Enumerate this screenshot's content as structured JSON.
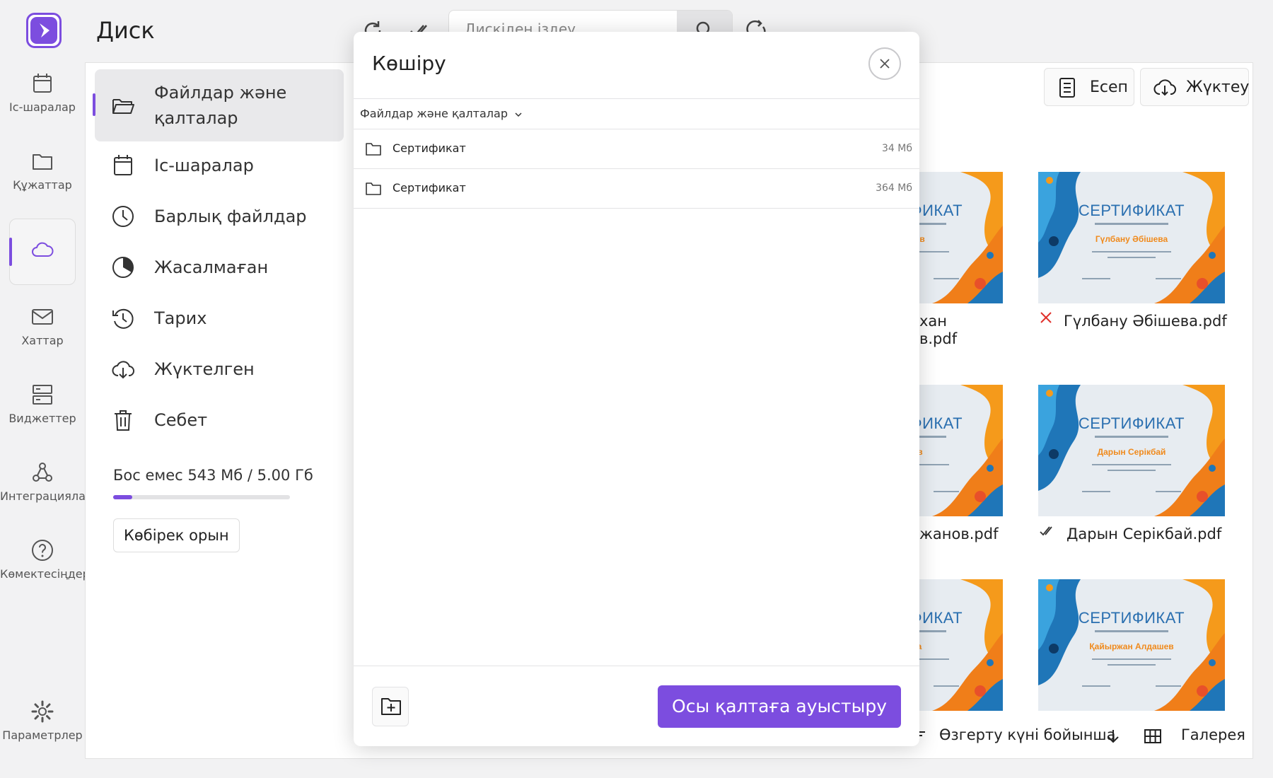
{
  "app": {
    "title": "Диск"
  },
  "rail": {
    "items": [
      {
        "label": "Іс-шаралар",
        "icon": "calendar-icon"
      },
      {
        "label": "Құжаттар",
        "icon": "folder-icon"
      },
      {
        "label": "",
        "icon": "cloud-icon",
        "active": true
      },
      {
        "label": "Хаттар",
        "icon": "mail-icon"
      },
      {
        "label": "Виджеттер",
        "icon": "widgets-icon"
      },
      {
        "label": "Интеграциялар",
        "icon": "integrations-icon"
      },
      {
        "label": "Көмектесіңдер",
        "icon": "help-icon"
      }
    ],
    "settings_label": "Параметрлер"
  },
  "search": {
    "placeholder": "Дискіден іздеу"
  },
  "sidebar": {
    "items": [
      {
        "label": "Файлдар және қалталар",
        "icon": "folder-open-icon",
        "active": true
      },
      {
        "label": "Іс-шаралар",
        "icon": "calendar-icon"
      },
      {
        "label": "Барлық файлдар",
        "icon": "clock-icon"
      },
      {
        "label": "Жасалмаған",
        "icon": "pie-icon"
      },
      {
        "label": "Тарих",
        "icon": "history-icon"
      },
      {
        "label": "Жүктелген",
        "icon": "cloud-download-icon"
      },
      {
        "label": "Себет",
        "icon": "trash-icon"
      }
    ],
    "storage_text": "Бос емес 543 Мб / 5.00 Гб",
    "storage_used_fraction": 0.106,
    "more_space_label": "Көбірек орын"
  },
  "toolbar": {
    "report_label": "Есеп",
    "upload_label": "Жүктеу"
  },
  "gallery": {
    "cert_heading": "СЕРТИФИКАТ",
    "visible_heading_fragment": "ИКАТ",
    "files": [
      {
        "name_fragment": "хан",
        "name_fragment2": "в.pdf",
        "cert_name_fragment": "ұқашев"
      },
      {
        "name": "Гүлбану Әбішева.pdf",
        "cert_name": "Гүлбану Әбішева",
        "status": "error"
      },
      {
        "name_fragment": "жанов.pdf",
        "cert_name_fragment": "жанов"
      },
      {
        "name": "Дарын Серікбай.pdf",
        "cert_name": "Дарын Серікбай",
        "status": "done"
      },
      {
        "cert_name_fragment": "раева"
      },
      {
        "cert_name": "Қайыржан Алдашев"
      }
    ]
  },
  "sort": {
    "label": "Өзгерту күні бойынша",
    "view_label": "Галерея"
  },
  "modal": {
    "title": "Көшіру",
    "breadcrumb": "Файлдар және қалталар",
    "folders": [
      {
        "name": "Сертификат",
        "size": "34 Мб"
      },
      {
        "name": "Сертификат",
        "size": "364 Мб"
      }
    ],
    "submit_label": "Осы қалтаға ауыстыру"
  },
  "colors": {
    "accent": "#7c4ddf",
    "error": "#e0302a",
    "cert_blue": "#1f76b8",
    "cert_orange": "#f59a1b"
  }
}
